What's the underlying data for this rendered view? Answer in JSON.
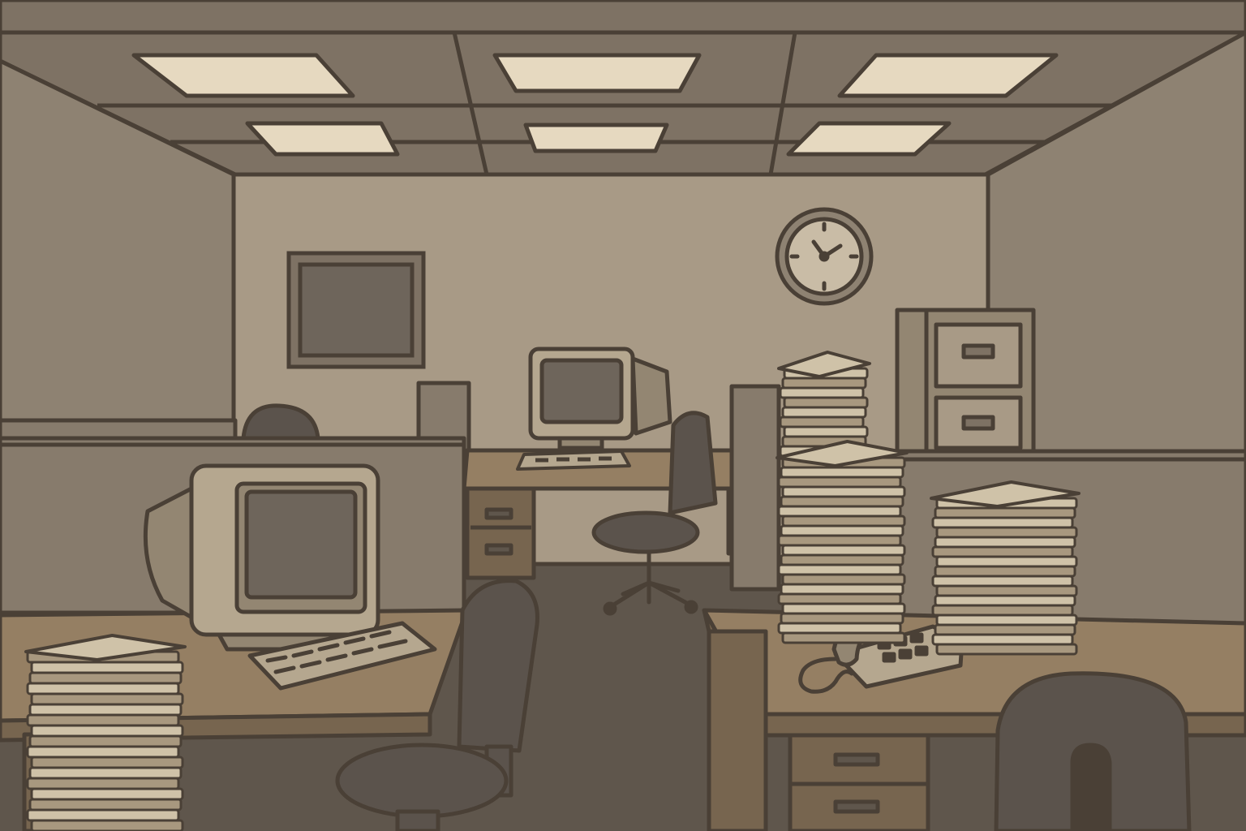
{
  "scene": {
    "kind": "illustration",
    "subject": "empty-office",
    "palette": {
      "outline": "#4a4036",
      "ceiling": "#7e7264",
      "ceiling_light": "#e6d9c0",
      "back_wall": "#a89a86",
      "side_wall": "#8e8272",
      "partition": "#877b6c",
      "floor": "#5f564c",
      "desk_top": "#957f63",
      "desk_front": "#77654f",
      "monitor_body": "#b5a78f",
      "monitor_screen": "#6e655b",
      "chair": "#5b534c",
      "paper": "#cfc2a8",
      "paper_edge": "#a8987f",
      "cabinet": "#938672",
      "clock_face": "#c9bca6"
    },
    "icons": [
      "ceiling-light-icon",
      "wall-clock-icon",
      "picture-frame-icon",
      "crt-monitor-icon",
      "keyboard-icon",
      "office-chair-icon",
      "paper-stack-icon",
      "desk-phone-icon",
      "filing-cabinet-icon"
    ]
  }
}
